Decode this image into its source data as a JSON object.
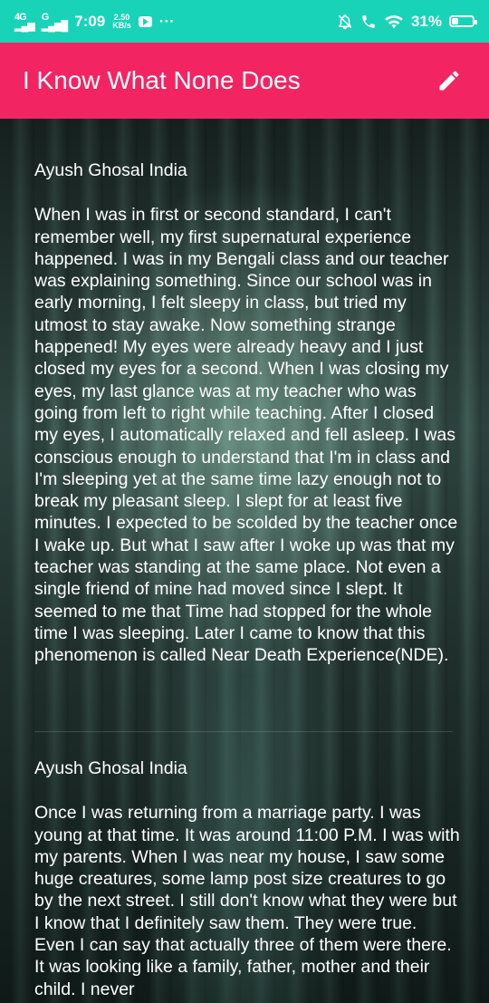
{
  "status_bar": {
    "network_1": "4G",
    "network_2": "G",
    "time": "7:09",
    "speed_value": "2.50",
    "speed_unit": "KB/s",
    "battery": "31%",
    "battery_level": 0.31
  },
  "app_bar": {
    "title": "I Know What None Does",
    "edit_icon": "pencil-icon"
  },
  "posts": [
    {
      "author": "Ayush Ghosal India",
      "text": "When I was in first or second standard, I can't remember well, my first supernatural experience happened. I was in my Bengali class and our teacher was explaining something. Since our school was in early morning, I felt sleepy in class, but tried my utmost to stay awake. Now something strange happened! My eyes were already heavy and I just closed my eyes for a second. When I was closing my eyes, my last glance was at my teacher who was going from left to right while teaching. After I closed my eyes, I automatically relaxed and fell asleep. I was conscious enough to understand that I'm in class and I'm sleeping yet at the same time lazy enough not to break my pleasant sleep. I slept for at least five minutes. I expected to be scolded by the teacher once I wake up. But what I saw after I woke up was that my teacher was standing at the same place. Not even a single friend of mine had moved since I slept. It seemed to me that Time had stopped for the whole time I was sleeping. Later I came to know that this phenomenon is called Near Death Experience(NDE)."
    },
    {
      "author": "Ayush Ghosal India",
      "text": "Once I was returning from a marriage party. I was young at that time. It was around 11:00 P.M. I was with my parents. When I was near my house, I saw some huge creatures, some lamp post size creatures to go by the next street. I still don't know what they were but I know that I definitely saw them. They were true. Even I can say that actually three of them were there. It was looking like a family, father, mother and their child. I never"
    }
  ]
}
